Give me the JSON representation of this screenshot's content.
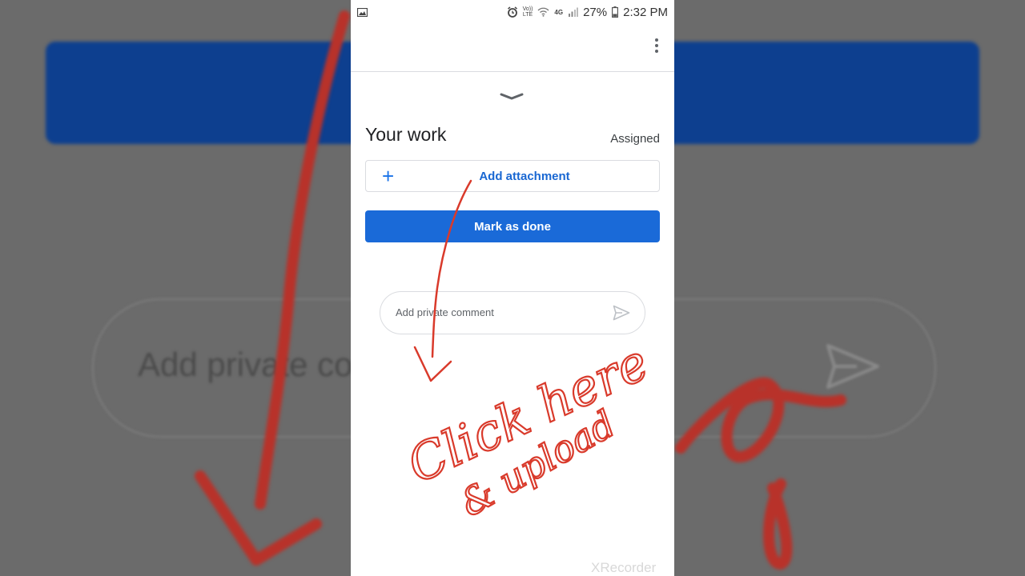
{
  "status_bar": {
    "time": "2:32 PM",
    "battery": "27%",
    "network_top": "Vo))",
    "network_bottom": "LTE",
    "signal_type": "4G",
    "icons": [
      "image-icon",
      "alarm-icon",
      "wifi-icon",
      "signal-icon",
      "battery-icon"
    ]
  },
  "app_bar": {
    "menu_icon": "more-vert-icon"
  },
  "work": {
    "title": "Your work",
    "status": "Assigned",
    "add_attachment_label": "Add attachment",
    "mark_done_label": "Mark as done"
  },
  "comment": {
    "placeholder": "Add private comment",
    "value": ""
  },
  "annotation": {
    "line1": "Click here",
    "line2": "& upload",
    "color": "#d93a2b"
  },
  "background": {
    "comment_text": "Add private co"
  },
  "watermark": "XRecorder",
  "colors": {
    "accent": "#1a73e8",
    "button": "#1a6ad8",
    "divider": "#dadce0"
  }
}
